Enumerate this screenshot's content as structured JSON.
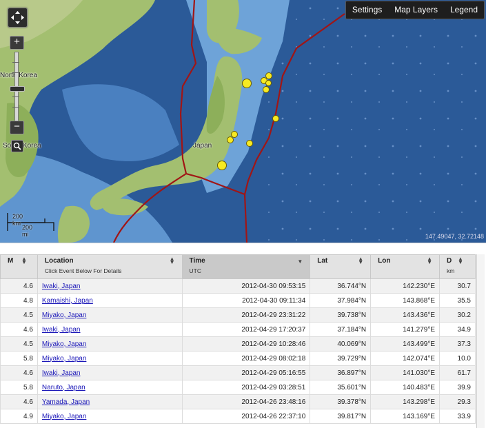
{
  "map": {
    "menu": {
      "settings": "Settings",
      "layers": "Map Layers",
      "legend": "Legend"
    },
    "labels": {
      "north_korea": "North Korea",
      "south_korea": "South Korea",
      "japan": "Japan"
    },
    "scale": {
      "km": "200 km",
      "mi": "200 mi"
    },
    "coordinates": "147.49047, 32.72148",
    "colors": {
      "ocean": "#2f5f9e",
      "land": "#9fbc6a",
      "plate_boundary": "#a11515",
      "event_marker": "#f7ea22"
    }
  },
  "table": {
    "columns": [
      {
        "label": "M",
        "sub": ""
      },
      {
        "label": "Location",
        "sub": "Click Event Below For Details"
      },
      {
        "label": "Time",
        "sub": "UTC"
      },
      {
        "label": "Lat",
        "sub": ""
      },
      {
        "label": "Lon",
        "sub": ""
      },
      {
        "label": "D",
        "sub": "km"
      }
    ],
    "rows": [
      {
        "m": "4.6",
        "location": "Iwaki, Japan",
        "time": "2012-04-30 09:53:15",
        "lat": "36.744°N",
        "lon": "142.230°E",
        "depth": "30.7"
      },
      {
        "m": "4.8",
        "location": "Kamaishi, Japan",
        "time": "2012-04-30 09:11:34",
        "lat": "37.984°N",
        "lon": "143.868°E",
        "depth": "35.5"
      },
      {
        "m": "4.5",
        "location": "Miyako, Japan",
        "time": "2012-04-29 23:31:22",
        "lat": "39.738°N",
        "lon": "143.436°E",
        "depth": "30.2"
      },
      {
        "m": "4.6",
        "location": "Iwaki, Japan",
        "time": "2012-04-29 17:20:37",
        "lat": "37.184°N",
        "lon": "141.279°E",
        "depth": "34.9"
      },
      {
        "m": "4.5",
        "location": "Miyako, Japan",
        "time": "2012-04-29 10:28:46",
        "lat": "40.069°N",
        "lon": "143.499°E",
        "depth": "37.3"
      },
      {
        "m": "5.8",
        "location": "Miyako, Japan",
        "time": "2012-04-29 08:02:18",
        "lat": "39.729°N",
        "lon": "142.074°E",
        "depth": "10.0"
      },
      {
        "m": "4.6",
        "location": "Iwaki, Japan",
        "time": "2012-04-29 05:16:55",
        "lat": "36.897°N",
        "lon": "141.030°E",
        "depth": "61.7"
      },
      {
        "m": "5.8",
        "location": "Naruto, Japan",
        "time": "2012-04-29 03:28:51",
        "lat": "35.601°N",
        "lon": "140.483°E",
        "depth": "39.9"
      },
      {
        "m": "4.6",
        "location": "Yamada, Japan",
        "time": "2012-04-26 23:48:16",
        "lat": "39.378°N",
        "lon": "143.298°E",
        "depth": "29.3"
      },
      {
        "m": "4.9",
        "location": "Miyako, Japan",
        "time": "2012-04-26 22:37:10",
        "lat": "39.817°N",
        "lon": "143.169°E",
        "depth": "33.9"
      }
    ]
  }
}
